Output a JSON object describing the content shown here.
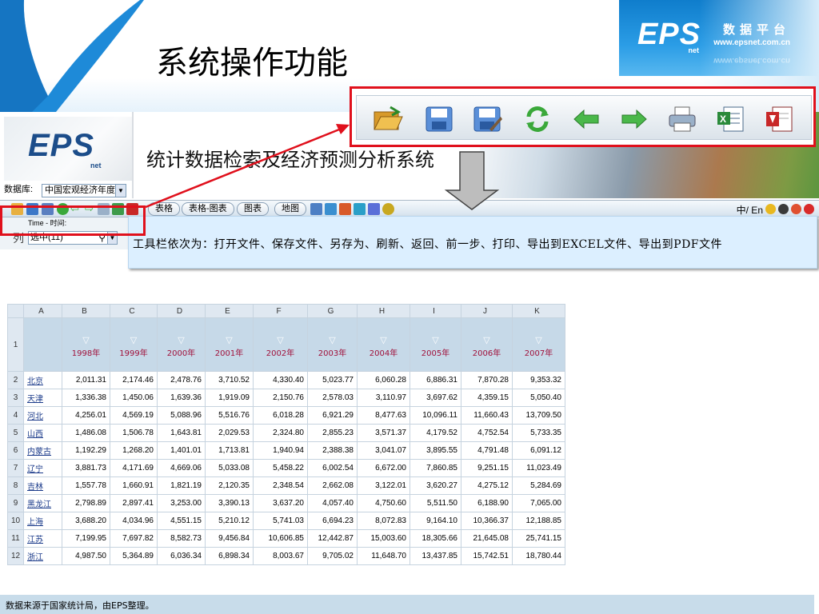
{
  "slide": {
    "title": "系统操作功能"
  },
  "brand": {
    "logo": "EPS",
    "logo_sub": "net",
    "name_cn": "数据平台",
    "url": "www.epsnet.com.cn",
    "accent": "#1b84d4"
  },
  "app": {
    "logo": "EPS",
    "logo_sub": "net",
    "system_name": "统计数据检索及经济预测分析系统",
    "db_label": "数据库:",
    "db_value": "中国宏观经济年度...",
    "toolbar": {
      "icons": [
        "open-file-icon",
        "save-icon",
        "save-as-icon",
        "refresh-icon",
        "back-icon",
        "forward-icon",
        "print-icon",
        "export-excel-icon",
        "export-pdf-icon"
      ],
      "tabs": [
        "表格",
        "表格-图表",
        "图表",
        "地图"
      ],
      "lang": "中/ En"
    },
    "column_panel": {
      "time_label": "Time - 时间:",
      "col_label": "列",
      "col_select": "选中(11)"
    },
    "description": "工具栏依次为：打开文件、保存文件、另存为、刷新、返回、前一步、打印、导出到EXCEL文件、导出到PDF文件",
    "sheet": {
      "col_letters": [
        "A",
        "B",
        "C",
        "D",
        "E",
        "F",
        "G",
        "H",
        "I",
        "J",
        "K"
      ],
      "years": [
        "1998年",
        "1999年",
        "2000年",
        "2001年",
        "2002年",
        "2003年",
        "2004年",
        "2005年",
        "2006年",
        "2007年"
      ],
      "rows": [
        {
          "n": "2",
          "prov": "北京",
          "v": [
            "2,011.31",
            "2,174.46",
            "2,478.76",
            "3,710.52",
            "4,330.40",
            "5,023.77",
            "6,060.28",
            "6,886.31",
            "7,870.28",
            "9,353.32"
          ]
        },
        {
          "n": "3",
          "prov": "天津",
          "v": [
            "1,336.38",
            "1,450.06",
            "1,639.36",
            "1,919.09",
            "2,150.76",
            "2,578.03",
            "3,110.97",
            "3,697.62",
            "4,359.15",
            "5,050.40"
          ]
        },
        {
          "n": "4",
          "prov": "河北",
          "v": [
            "4,256.01",
            "4,569.19",
            "5,088.96",
            "5,516.76",
            "6,018.28",
            "6,921.29",
            "8,477.63",
            "10,096.11",
            "11,660.43",
            "13,709.50"
          ]
        },
        {
          "n": "5",
          "prov": "山西",
          "v": [
            "1,486.08",
            "1,506.78",
            "1,643.81",
            "2,029.53",
            "2,324.80",
            "2,855.23",
            "3,571.37",
            "4,179.52",
            "4,752.54",
            "5,733.35"
          ]
        },
        {
          "n": "6",
          "prov": "内蒙古",
          "v": [
            "1,192.29",
            "1,268.20",
            "1,401.01",
            "1,713.81",
            "1,940.94",
            "2,388.38",
            "3,041.07",
            "3,895.55",
            "4,791.48",
            "6,091.12"
          ]
        },
        {
          "n": "7",
          "prov": "辽宁",
          "v": [
            "3,881.73",
            "4,171.69",
            "4,669.06",
            "5,033.08",
            "5,458.22",
            "6,002.54",
            "6,672.00",
            "7,860.85",
            "9,251.15",
            "11,023.49"
          ]
        },
        {
          "n": "8",
          "prov": "吉林",
          "v": [
            "1,557.78",
            "1,660.91",
            "1,821.19",
            "2,120.35",
            "2,348.54",
            "2,662.08",
            "3,122.01",
            "3,620.27",
            "4,275.12",
            "5,284.69"
          ]
        },
        {
          "n": "9",
          "prov": "黑龙江",
          "v": [
            "2,798.89",
            "2,897.41",
            "3,253.00",
            "3,390.13",
            "3,637.20",
            "4,057.40",
            "4,750.60",
            "5,511.50",
            "6,188.90",
            "7,065.00"
          ]
        },
        {
          "n": "10",
          "prov": "上海",
          "v": [
            "3,688.20",
            "4,034.96",
            "4,551.15",
            "5,210.12",
            "5,741.03",
            "6,694.23",
            "8,072.83",
            "9,164.10",
            "10,366.37",
            "12,188.85"
          ]
        },
        {
          "n": "11",
          "prov": "江苏",
          "v": [
            "7,199.95",
            "7,697.82",
            "8,582.73",
            "9,456.84",
            "10,606.85",
            "12,442.87",
            "15,003.60",
            "18,305.66",
            "21,645.08",
            "25,741.15"
          ]
        },
        {
          "n": "12",
          "prov": "浙江",
          "v": [
            "4,987.50",
            "5,364.89",
            "6,036.34",
            "6,898.34",
            "8,003.67",
            "9,705.02",
            "11,648.70",
            "13,437.85",
            "15,742.51",
            "18,780.44"
          ]
        }
      ]
    },
    "footer": "数据来源于国家统计局，由EPS整理。"
  },
  "highlight_color": "#e0101c"
}
